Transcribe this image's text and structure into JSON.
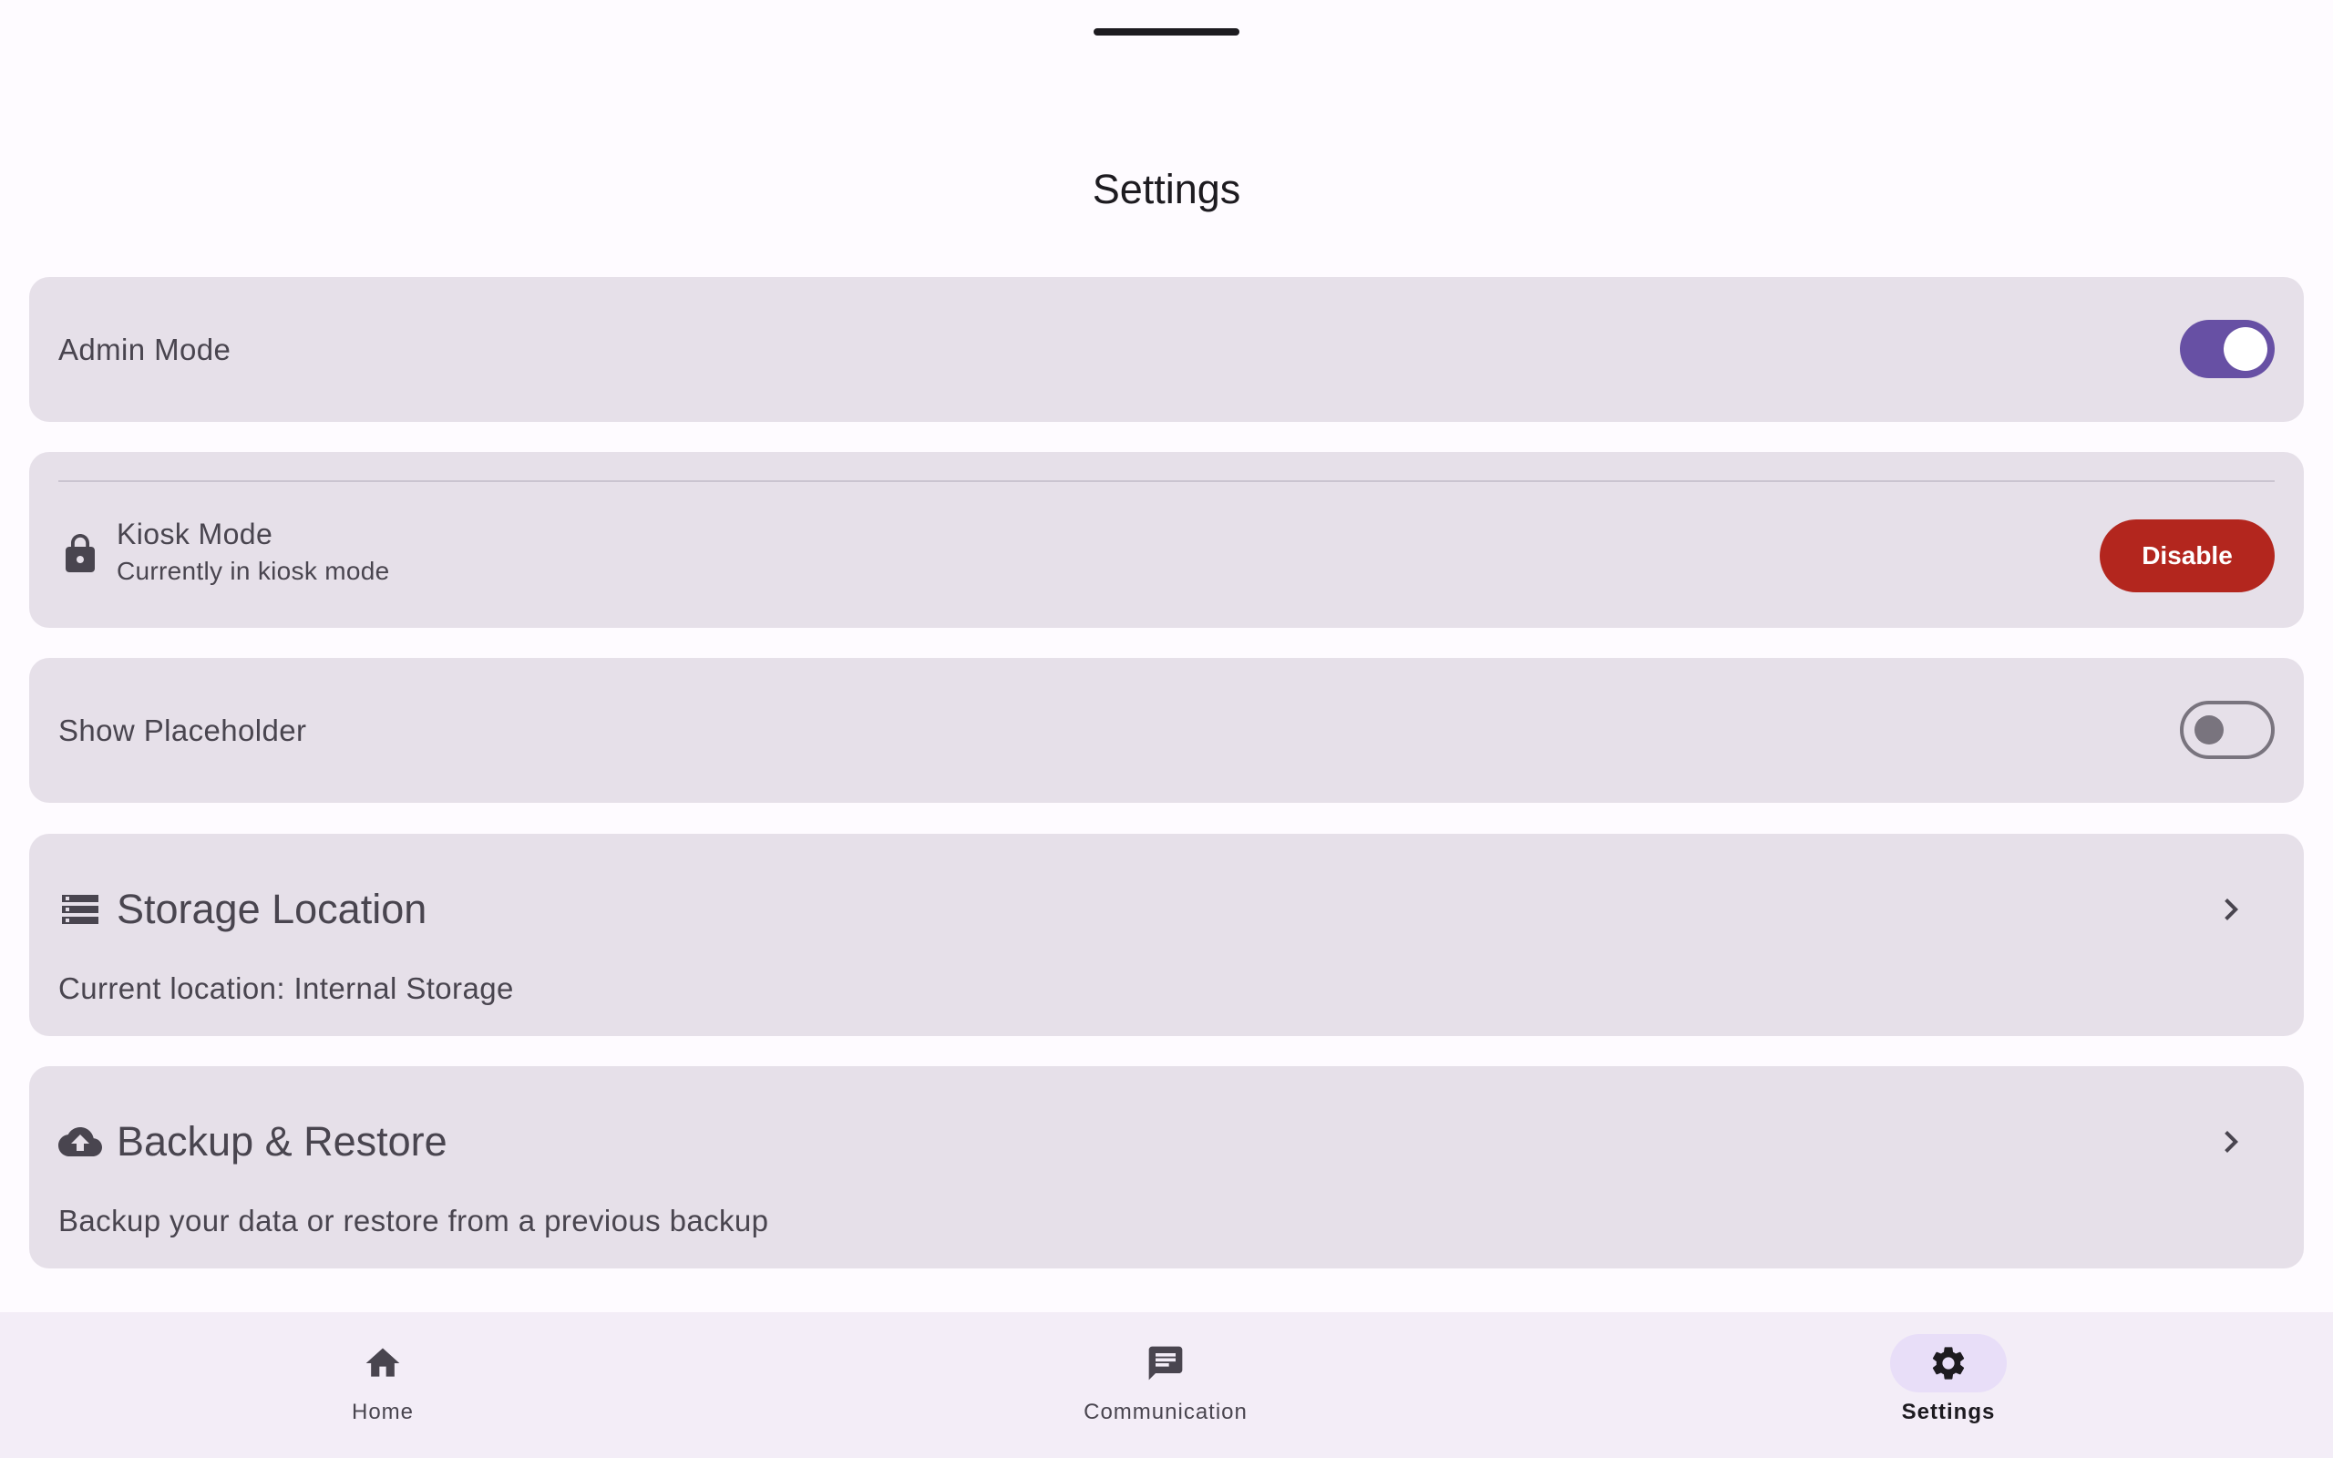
{
  "page": {
    "title": "Settings"
  },
  "admin_mode": {
    "label": "Admin Mode",
    "enabled": true
  },
  "kiosk_mode": {
    "title": "Kiosk Mode",
    "subtitle": "Currently in kiosk mode",
    "button_label": "Disable",
    "icon": "lock-icon"
  },
  "show_placeholder": {
    "label": "Show Placeholder",
    "enabled": false
  },
  "storage_location": {
    "title": "Storage Location",
    "description": "Current location: Internal Storage",
    "icon": "storage-icon"
  },
  "backup_restore": {
    "title": "Backup & Restore",
    "description": "Backup your data or restore from a previous backup",
    "icon": "cloud-upload-icon"
  },
  "bottom_nav": {
    "items": [
      {
        "label": "Home",
        "icon": "home-icon",
        "selected": false
      },
      {
        "label": "Communication",
        "icon": "chat-icon",
        "selected": false
      },
      {
        "label": "Settings",
        "icon": "gear-icon",
        "selected": true
      }
    ]
  },
  "colors": {
    "background": "#fefbff",
    "card": "#e6e0e9",
    "primary": "#6750a4",
    "error": "#b3261e",
    "nav_background": "#f3edf7",
    "nav_indicator": "#e8def8"
  }
}
